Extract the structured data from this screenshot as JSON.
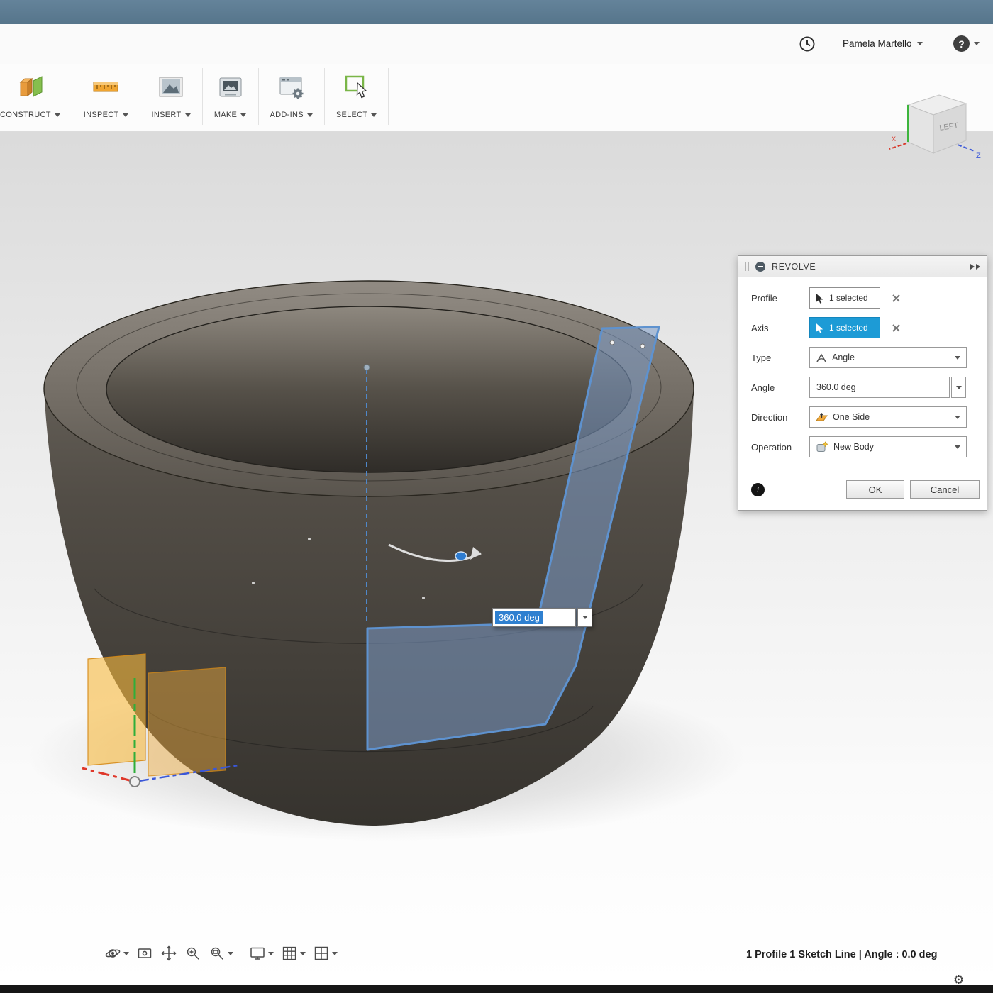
{
  "colors": {
    "topbar": "#5d7c92",
    "accent_blue": "#1d9bd6",
    "profile_blue": "#5e92cf",
    "plane_orange": "#f5a623"
  },
  "icons": {
    "help_glyph": "?",
    "info_glyph": "i",
    "gear_glyph": "⚙"
  },
  "header": {
    "user_name": "Pamela Martello"
  },
  "ribbon": {
    "items": [
      {
        "label": "CONSTRUCT"
      },
      {
        "label": "INSPECT"
      },
      {
        "label": "INSERT"
      },
      {
        "label": "MAKE"
      },
      {
        "label": "ADD-INS"
      },
      {
        "label": "SELECT"
      }
    ]
  },
  "viewcube": {
    "face": "LEFT",
    "axis_x": "X",
    "axis_z": "Z"
  },
  "dialog": {
    "title": "REVOLVE",
    "rows": {
      "profile": {
        "label": "Profile",
        "value": "1 selected"
      },
      "axis": {
        "label": "Axis",
        "value": "1 selected"
      },
      "type": {
        "label": "Type",
        "value": "Angle"
      },
      "angle": {
        "label": "Angle",
        "value": "360.0 deg"
      },
      "direction": {
        "label": "Direction",
        "value": "One Side"
      },
      "operation": {
        "label": "Operation",
        "value": "New Body"
      }
    },
    "ok": "OK",
    "cancel": "Cancel"
  },
  "canvas": {
    "angle_input": "360.0 deg"
  },
  "status": {
    "text": "1 Profile 1 Sketch Line | Angle : 0.0 deg"
  }
}
